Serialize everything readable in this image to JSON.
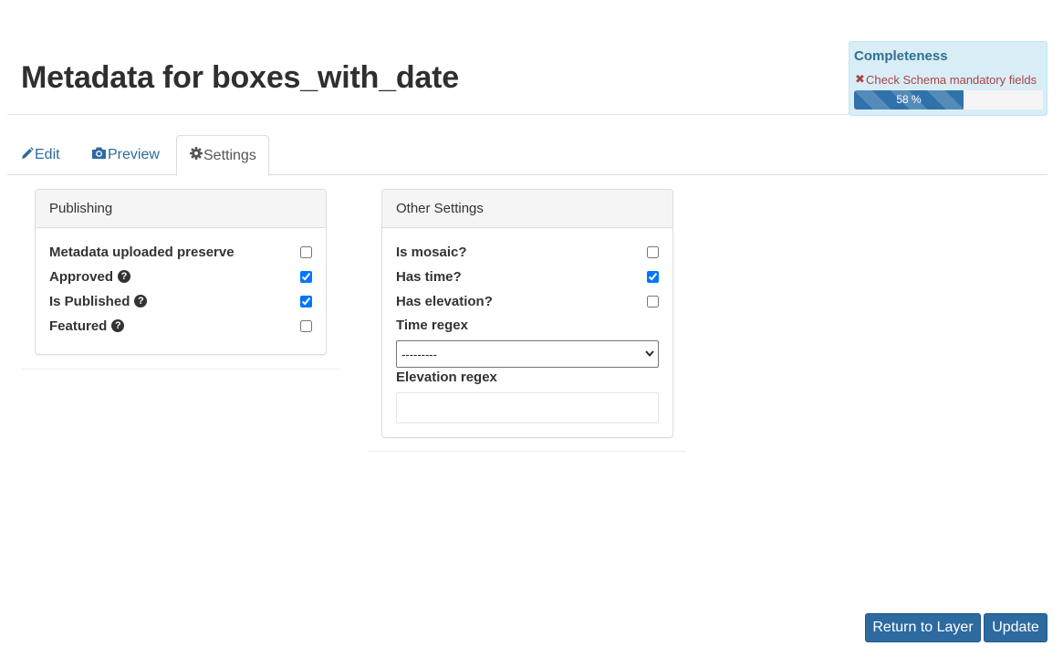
{
  "page": {
    "title": "Metadata for boxes_with_date"
  },
  "completeness": {
    "title": "Completeness",
    "message": "Check Schema mandatory fields",
    "message_icon": "x-icon",
    "progress_percent": 58,
    "progress_label": "58 %"
  },
  "tabs": [
    {
      "label": "Edit",
      "icon": "pencil-icon",
      "active": false
    },
    {
      "label": "Preview",
      "icon": "camera-icon",
      "active": false
    },
    {
      "label": "Settings",
      "icon": "gear-icon",
      "active": true
    }
  ],
  "publishing": {
    "heading": "Publishing",
    "items": [
      {
        "label": "Metadata uploaded preserve",
        "help": false,
        "checked": false
      },
      {
        "label": "Approved",
        "help": true,
        "checked": true
      },
      {
        "label": "Is Published",
        "help": true,
        "checked": true
      },
      {
        "label": "Featured",
        "help": true,
        "checked": false
      }
    ]
  },
  "other_settings": {
    "heading": "Other Settings",
    "items": [
      {
        "label": "Is mosaic?",
        "checked": false
      },
      {
        "label": "Has time?",
        "checked": true
      },
      {
        "label": "Has elevation?",
        "checked": false
      }
    ],
    "time_regex_label": "Time regex",
    "time_regex_value": "---------",
    "elevation_regex_label": "Elevation regex",
    "elevation_regex_value": ""
  },
  "buttons": {
    "return_label": "Return to Layer",
    "update_label": "Update"
  },
  "colors": {
    "primary": "#2c6aa0",
    "completeness_bg": "#d9edf7",
    "error_text": "#a94442"
  }
}
